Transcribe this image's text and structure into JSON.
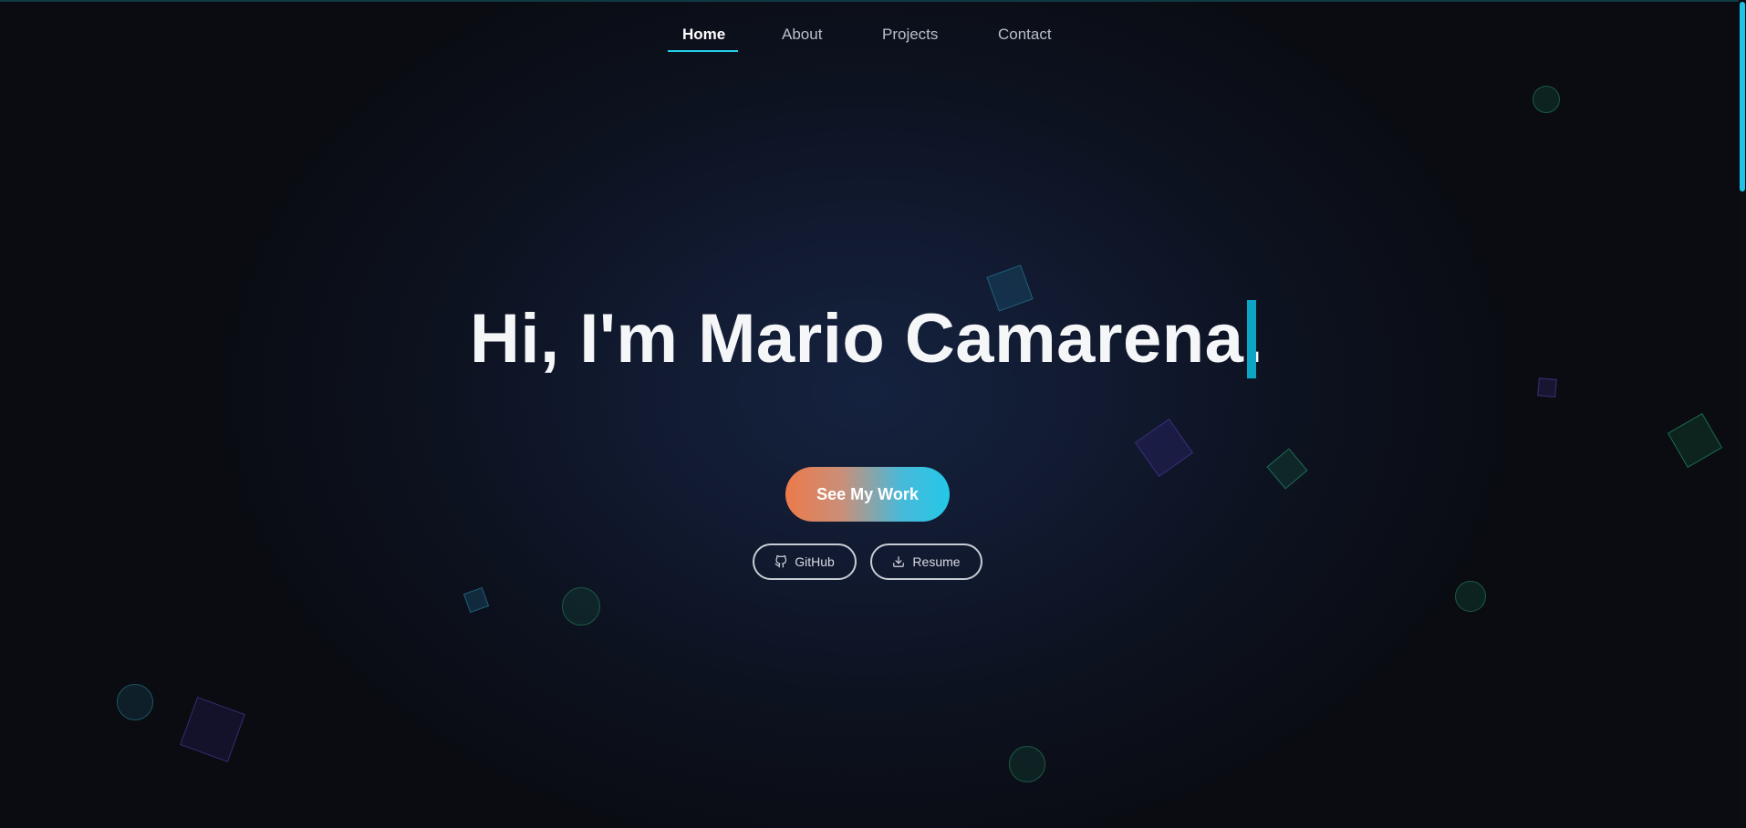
{
  "nav": {
    "items": [
      {
        "label": "Home",
        "active": true
      },
      {
        "label": "About",
        "active": false
      },
      {
        "label": "Projects",
        "active": false
      },
      {
        "label": "Contact",
        "active": false
      }
    ]
  },
  "hero": {
    "headline": "Hi, I'm Mario Camarena.",
    "cta_label": "See My Work",
    "links": [
      {
        "label": "GitHub",
        "icon": "github-icon"
      },
      {
        "label": "Resume",
        "icon": "download-icon"
      }
    ]
  },
  "colors": {
    "accent": "#22d3ee",
    "cta_start": "#ec7a4a",
    "cta_end": "#23c8e8",
    "background": "#0b0d12"
  }
}
